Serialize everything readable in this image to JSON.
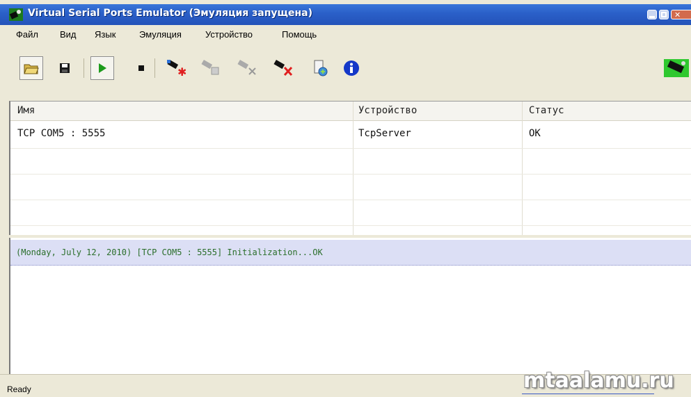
{
  "window": {
    "title": "Virtual Serial Ports Emulator (Эмуляция запущена)"
  },
  "menu": {
    "items": [
      "Файл",
      "Вид",
      "Язык",
      "Эмуляция",
      "Устройство",
      "Помощь"
    ]
  },
  "toolbar": {
    "icons": [
      "open-folder-icon",
      "save-icon",
      "play-icon",
      "stop-icon",
      "new-device-icon",
      "edit-device-icon",
      "unplug-device-icon",
      "delete-device-icon",
      "ports-config-icon",
      "info-icon",
      "network-card-icon"
    ]
  },
  "table": {
    "headers": [
      "Имя",
      "Устройство",
      "Статус"
    ],
    "rows": [
      [
        "TCP COM5 : 5555",
        "TcpServer",
        "OK"
      ]
    ]
  },
  "log": {
    "lines": [
      "(Monday, July 12, 2010) [TCP COM5 : 5555] Initialization...OK"
    ]
  },
  "status": {
    "text": "Ready"
  },
  "watermark": "mtaalamu.ru",
  "colors": {
    "titlebar": "#2a5fc8",
    "log_highlight": "#dcdff5",
    "log_text": "#2a6e2a"
  }
}
